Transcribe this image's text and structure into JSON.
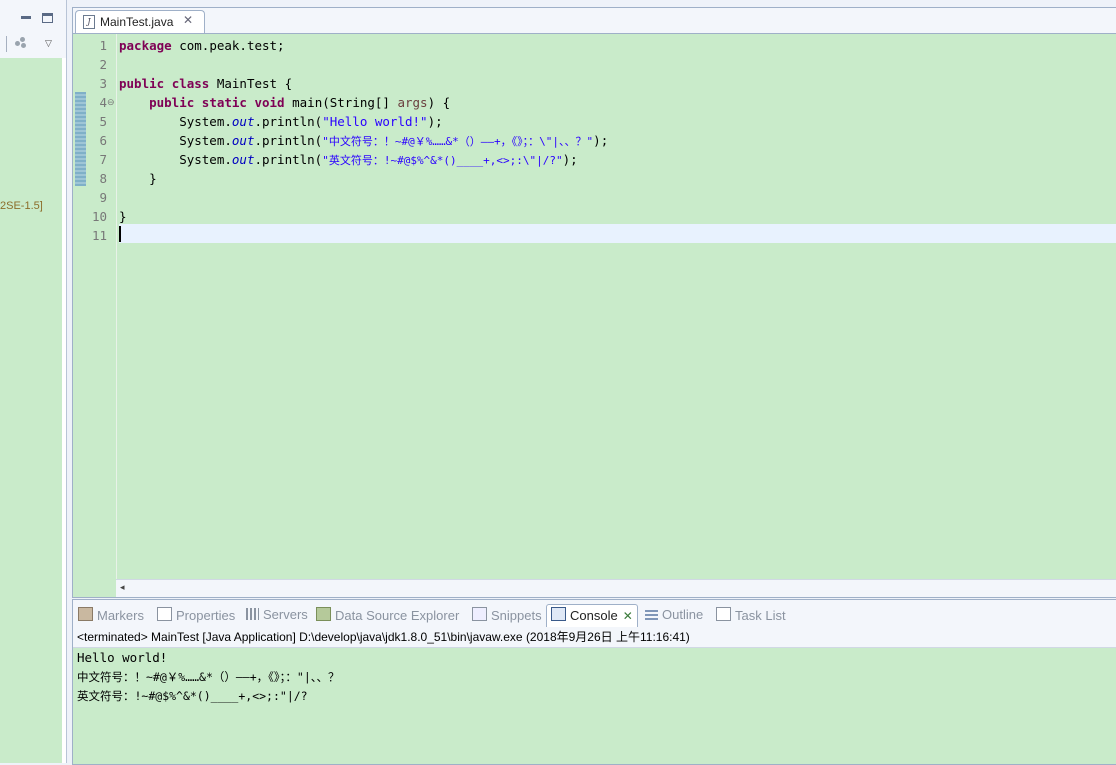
{
  "left_panel": {
    "minimize_icon": "minimize-icon",
    "maximize_icon": "maximize-icon",
    "filter_icon": "filter-icon",
    "menu_icon": "view-menu-icon",
    "jre_label": "2SE-1.5]"
  },
  "editor": {
    "tab": {
      "label": "MainTest.java",
      "icon": "java-file-icon",
      "close": "✕"
    },
    "line_numbers": [
      "1",
      "2",
      "3",
      "4",
      "5",
      "6",
      "7",
      "8",
      "9",
      "10",
      "11"
    ],
    "code": {
      "l1_kw": "package",
      "l1_rest": " com.peak.test;",
      "l3_kw1": "public",
      "l3_kw2": "class",
      "l3_rest": " MainTest {",
      "l4_indent": "    ",
      "l4_kw1": "public",
      "l4_kw2": "static",
      "l4_kw3": "void",
      "l4_mid": " main(String[] ",
      "l4_param": "args",
      "l4_end": ") {",
      "sys_prefix": "        System.",
      "out": "out",
      "println": ".println(",
      "l5_str": "\"Hello world!\"",
      "l6_str": "\"中文符号：！~#@￥%……&*（）——+，《》；：\\\"|、、？\"",
      "l7_str": "\"英文符号：!~#@$%^&*()____+,<>;:\\\"|/?\"",
      "close_paren": ");",
      "l8": "    }",
      "l10": "}"
    }
  },
  "views": {
    "tabs": [
      {
        "label": "Markers",
        "icon": "markers-icon"
      },
      {
        "label": "Properties",
        "icon": "properties-icon"
      },
      {
        "label": "Servers",
        "icon": "servers-icon"
      },
      {
        "label": "Data Source Explorer",
        "icon": "data-source-icon"
      },
      {
        "label": "Snippets",
        "icon": "snippets-icon"
      },
      {
        "label": "Console",
        "icon": "console-icon"
      },
      {
        "label": "Outline",
        "icon": "outline-icon"
      },
      {
        "label": "Task List",
        "icon": "task-list-icon"
      }
    ],
    "console_close": "✕"
  },
  "console": {
    "header": "<terminated> MainTest [Java Application] D:\\develop\\java\\jdk1.8.0_51\\bin\\javaw.exe (2018年9月26日 上午11:16:41)",
    "output": [
      "Hello world!",
      "中文符号：！~#@￥%……&*（）——+，《》；：\"|、、？",
      "英文符号：!~#@$%^&*()____+,<>;:\"|/?"
    ]
  }
}
